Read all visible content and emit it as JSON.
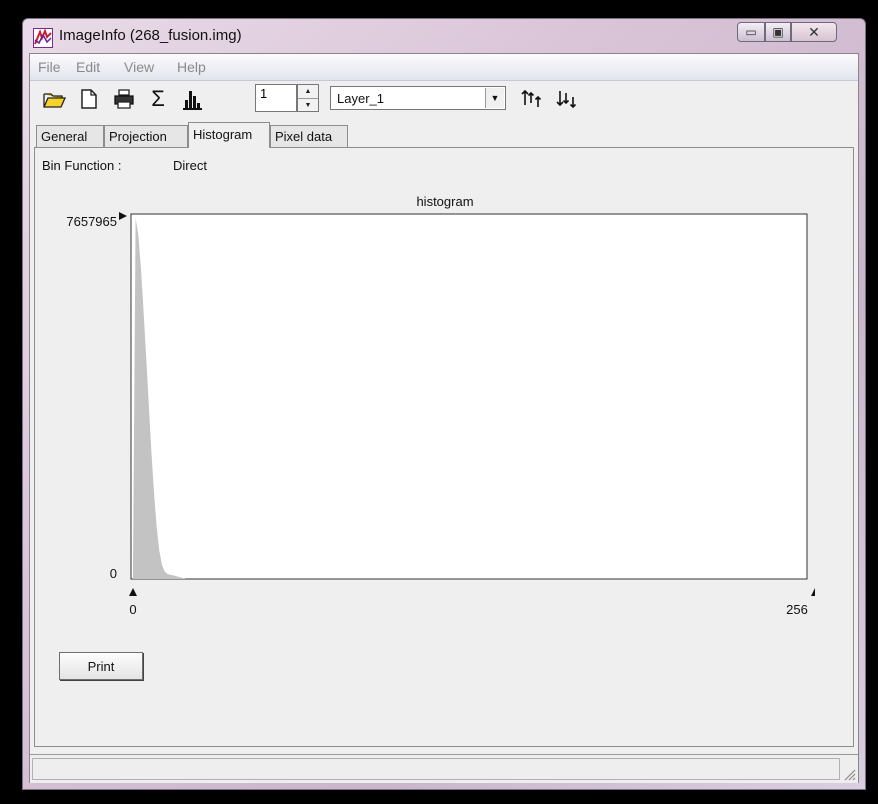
{
  "window": {
    "title": "ImageInfo (268_fusion.img)"
  },
  "titlebar": {
    "minimize_glyph": "▭",
    "maximize_glyph": "▣",
    "close_glyph": "✕"
  },
  "menu": [
    {
      "label": "File"
    },
    {
      "label": "Edit"
    },
    {
      "label": "View"
    },
    {
      "label": "Help"
    }
  ],
  "toolbar": {
    "buttons": [
      {
        "icon": "open-folder-icon"
      },
      {
        "icon": "new-document-icon"
      },
      {
        "icon": "printer-icon"
      },
      {
        "icon": "sigma-icon",
        "glyph": "Σ"
      },
      {
        "icon": "histogram-icon"
      }
    ],
    "layer_number": "1",
    "layer_select": {
      "value": "Layer_1"
    },
    "sort_up_icon": "sort-ascending-icon",
    "sort_down_icon": "sort-descending-icon"
  },
  "tabs": [
    {
      "label": "General",
      "active": false
    },
    {
      "label": "Projection",
      "active": false
    },
    {
      "label": "Histogram",
      "active": true
    },
    {
      "label": "Pixel data",
      "active": false
    }
  ],
  "histogram": {
    "bin_function_label": "Bin Function :",
    "bin_function_value": "Direct",
    "print_label": "Print"
  },
  "chart_data": {
    "type": "area",
    "title": "histogram",
    "xlim": [
      0,
      256
    ],
    "ylim": [
      0,
      7657965
    ],
    "y_max_label": "7657965",
    "y_min_label": "0",
    "x_min_label": "0",
    "x_max_label": "256",
    "x": [
      0,
      1,
      2,
      3,
      4,
      5,
      6,
      7,
      8,
      9,
      10,
      11,
      12,
      13,
      14,
      15,
      16,
      17,
      18,
      19,
      20
    ],
    "values": [
      200000,
      7657965,
      7300000,
      6600000,
      5700000,
      4700000,
      3700000,
      2700000,
      1800000,
      1100000,
      600000,
      300000,
      160000,
      110000,
      90000,
      80000,
      65000,
      50000,
      35000,
      20000,
      0
    ],
    "fill_color": "#c3c3c3",
    "grid": false
  }
}
